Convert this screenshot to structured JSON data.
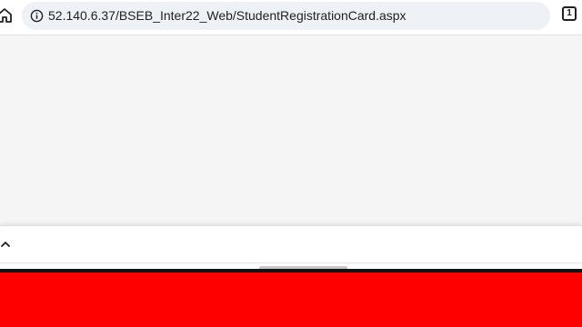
{
  "browser": {
    "url": "52.140.6.37/BSEB_Inter22_Web/StudentRegistrationCard.aspx",
    "tab_count": "1",
    "home_icon": "home-icon",
    "info_icon": "info-icon",
    "tabs_icon": "tab-switcher-icon"
  },
  "bottom_sheet": {
    "expand_icon": "chevron-up-icon"
  },
  "colors": {
    "page_background": "#f5f5f5",
    "url_pill": "#eef1f5",
    "red_band": "#ff0000"
  }
}
